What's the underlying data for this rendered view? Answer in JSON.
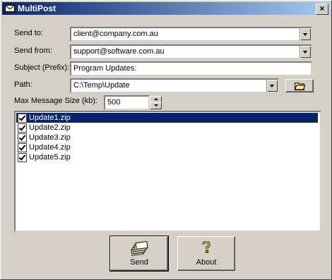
{
  "window": {
    "title": "MultiPost"
  },
  "fields": {
    "send_to": {
      "label": "Send to:",
      "value": "client@company.com.au"
    },
    "send_from": {
      "label": "Send from:",
      "value": "support@software.com.au"
    },
    "subject": {
      "label": "Subject (Prefix):",
      "value": "Program Updates:"
    },
    "path": {
      "label": "Path:",
      "value": "C:\\Temp\\Update"
    },
    "max_size": {
      "label": "Max Message Size (kb):",
      "value": "500"
    }
  },
  "files": [
    {
      "name": "Update1.zip",
      "checked": true,
      "selected": true
    },
    {
      "name": "Update2.zip",
      "checked": true,
      "selected": false
    },
    {
      "name": "Update3.zip",
      "checked": true,
      "selected": false
    },
    {
      "name": "Update4.zip",
      "checked": true,
      "selected": false
    },
    {
      "name": "Update5.zip",
      "checked": true,
      "selected": false
    }
  ],
  "buttons": {
    "send": "Send",
    "about": "About"
  },
  "icons": {
    "app": "envelope-icon",
    "browse": "folder-icon",
    "send": "mail-stack-icon",
    "about": "question-icon"
  },
  "colors": {
    "titlebar_start": "#0a246a",
    "titlebar_end": "#a6caf0",
    "selection": "#0a246a",
    "face": "#d4d0c8"
  }
}
